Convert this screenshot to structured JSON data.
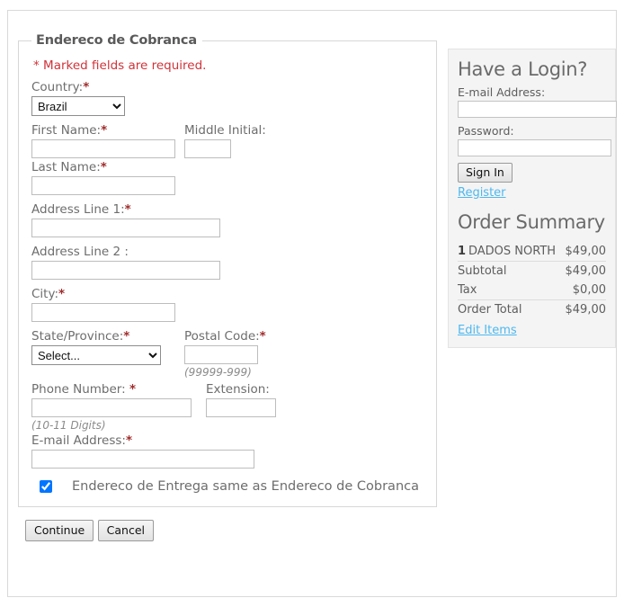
{
  "form": {
    "legend": "Endereco de Cobranca",
    "required_note": "* Marked fields are required.",
    "fields": {
      "country": {
        "label": "Country:",
        "required": true,
        "selected": "Brazil",
        "options": [
          "Brazil"
        ]
      },
      "first_name": {
        "label": "First Name:",
        "required": true,
        "value": ""
      },
      "middle_initial": {
        "label": "Middle Initial:",
        "required": false,
        "value": ""
      },
      "last_name": {
        "label": "Last Name:",
        "required": true,
        "value": ""
      },
      "address_line_1": {
        "label": "Address Line 1:",
        "required": true,
        "value": ""
      },
      "address_line_2": {
        "label": "Address Line 2 :",
        "required": false,
        "value": ""
      },
      "city": {
        "label": "City:",
        "required": true,
        "value": ""
      },
      "state_province": {
        "label": "State/Province:",
        "required": true,
        "selected": "Select...",
        "options": [
          "Select..."
        ]
      },
      "postal_code": {
        "label": "Postal Code:",
        "required": true,
        "value": "",
        "hint": "(99999-999)"
      },
      "phone_number": {
        "label": "Phone Number: ",
        "required": true,
        "value": "",
        "hint": "(10-11 Digits)"
      },
      "extension": {
        "label": "Extension:",
        "required": false,
        "value": ""
      },
      "email": {
        "label": "E-mail Address:",
        "required": true,
        "value": ""
      }
    },
    "same_address_checkbox": {
      "label": "Endereco de Entrega same as Endereco de Cobranca",
      "checked": true
    },
    "actions": {
      "continue_label": "Continue",
      "cancel_label": "Cancel"
    }
  },
  "sidebar": {
    "login": {
      "heading": "Have a Login?",
      "email_label": "E-mail Address:",
      "email_value": "",
      "password_label": "Password:",
      "password_value": "",
      "signin_label": "Sign In",
      "register_label": "Register"
    },
    "order_summary": {
      "heading": "Order Summary",
      "line_items": [
        {
          "qty": "1",
          "name": "DADOS NORTH",
          "amount": "$49,00"
        }
      ],
      "totals": [
        {
          "label": "Subtotal",
          "amount": "$49,00"
        },
        {
          "label": "Tax",
          "amount": "$0,00"
        }
      ],
      "order_total": {
        "label": "Order Total",
        "amount": "$49,00"
      },
      "edit_items_label": "Edit Items"
    }
  },
  "colors": {
    "required_red": "#d0333a",
    "asterisk": "#a02c2c",
    "label_gray": "#6d6d6d",
    "link_blue": "#4db8ef",
    "panel_bg": "#f4f4f4"
  }
}
